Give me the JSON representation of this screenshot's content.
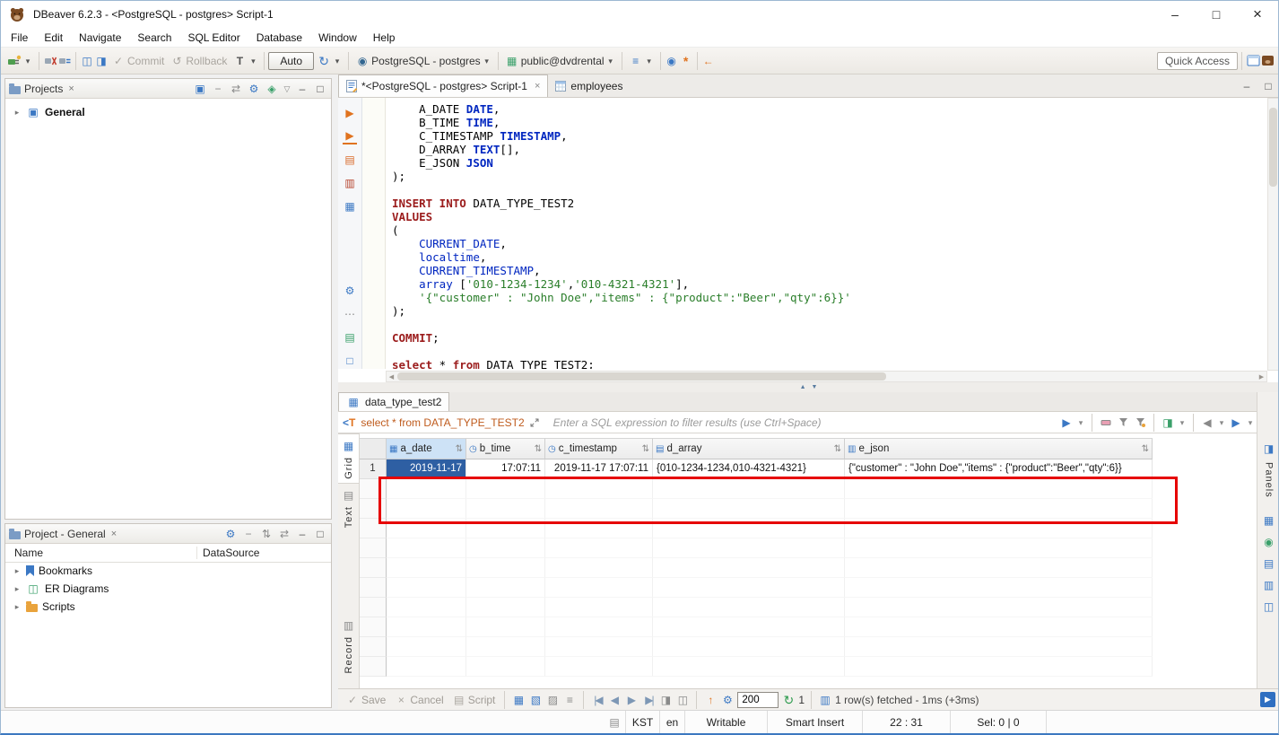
{
  "colors": {
    "keyword": "#9b1c1c",
    "datatype": "#0026c0",
    "string": "#2a7e2a",
    "filter_sql": "#bf5b1d",
    "selection_blue": "#2e5fa3",
    "header_selected": "#cde2f6",
    "annotation_red": "#e60000",
    "accent": "#3b78c4"
  },
  "icons": {
    "dropdown": "▾",
    "menu_down": "▽",
    "minimize": "–",
    "maximize": "□",
    "close": "×",
    "play": "▶",
    "back": "◀",
    "forward": "▶",
    "first": "|◀",
    "last": "▶|",
    "up": "↑",
    "refresh": "↻",
    "rollback": "↺",
    "check": "✓",
    "gear": "⚙",
    "link": "⇄",
    "sort": "⇅",
    "collapse": "−",
    "dots": "⋯",
    "list": "≡",
    "grid": "▦",
    "sheet": "▤",
    "record": "▥",
    "clock": "◷",
    "panel": "◨",
    "panel2": "◫",
    "diamond": "◈",
    "circle": "◉",
    "box": "▣",
    "square": "□",
    "asterisk": "*",
    "arrow_left": "←",
    "tri_up": "▲",
    "tri_down": "▼",
    "tfilter": "T",
    "shade1": "▧",
    "shade2": "▨"
  },
  "titlebar": {
    "title": "DBeaver 6.2.3 - <PostgreSQL - postgres> Script-1"
  },
  "menu": {
    "items": [
      "File",
      "Edit",
      "Navigate",
      "Search",
      "SQL Editor",
      "Database",
      "Window",
      "Help"
    ]
  },
  "toolbar": {
    "commit": "Commit",
    "rollback": "Rollback",
    "auto_commit": "Auto",
    "connection": "PostgreSQL - postgres",
    "schema": "public@dvdrental",
    "quick_access": "Quick Access"
  },
  "projects_panel": {
    "title": "Projects",
    "root_item": "General"
  },
  "project_panel": {
    "title": "Project - General",
    "columns": {
      "name": "Name",
      "datasource": "DataSource"
    },
    "items": [
      "Bookmarks",
      "ER Diagrams",
      "Scripts"
    ]
  },
  "editor": {
    "tab1": "*<PostgreSQL - postgres> Script-1",
    "tab2": "employees",
    "code": [
      [
        [
          "p",
          "    A_DATE "
        ],
        [
          "t",
          "DATE"
        ],
        [
          "p",
          ","
        ]
      ],
      [
        [
          "p",
          "    B_TIME "
        ],
        [
          "t",
          "TIME"
        ],
        [
          "p",
          ","
        ]
      ],
      [
        [
          "p",
          "    C_TIMESTAMP "
        ],
        [
          "t",
          "TIMESTAMP"
        ],
        [
          "p",
          ","
        ]
      ],
      [
        [
          "p",
          "    D_ARRAY "
        ],
        [
          "t",
          "TEXT"
        ],
        [
          "p",
          "[],"
        ]
      ],
      [
        [
          "p",
          "    E_JSON "
        ],
        [
          "t",
          "JSON"
        ]
      ],
      [
        [
          "p",
          ");"
        ]
      ],
      [],
      [
        [
          "k",
          "INSERT INTO"
        ],
        [
          "p",
          " DATA_TYPE_TEST2"
        ]
      ],
      [
        [
          "k",
          "VALUES"
        ]
      ],
      [
        [
          "p",
          "("
        ]
      ],
      [
        [
          "p",
          "    "
        ],
        [
          "f",
          "CURRENT_DATE"
        ],
        [
          "p",
          ","
        ]
      ],
      [
        [
          "p",
          "    "
        ],
        [
          "f",
          "localtime"
        ],
        [
          "p",
          ","
        ]
      ],
      [
        [
          "p",
          "    "
        ],
        [
          "f",
          "CURRENT_TIMESTAMP"
        ],
        [
          "p",
          ","
        ]
      ],
      [
        [
          "p",
          "    "
        ],
        [
          "f",
          "array"
        ],
        [
          "p",
          " ["
        ],
        [
          "s",
          "'010-1234-1234'"
        ],
        [
          "p",
          ","
        ],
        [
          "s",
          "'010-4321-4321'"
        ],
        [
          "p",
          "],"
        ]
      ],
      [
        [
          "p",
          "    "
        ],
        [
          "s",
          "'{\"customer\" : \"John Doe\",\"items\" : {\"product\":\"Beer\",\"qty\":6}}'"
        ]
      ],
      [
        [
          "p",
          ");"
        ]
      ],
      [],
      [
        [
          "k",
          "COMMIT"
        ],
        [
          "p",
          ";"
        ]
      ],
      [],
      [
        [
          "k",
          "select"
        ],
        [
          "p",
          " * "
        ],
        [
          "k",
          "from"
        ],
        [
          "p",
          " DATA_TYPE_TEST2;"
        ]
      ]
    ]
  },
  "results": {
    "tab": "data_type_test2",
    "filter_sql": "select * from DATA_TYPE_TEST2",
    "filter_placeholder": "Enter a SQL expression to filter results (use Ctrl+Space)",
    "side_tabs": [
      "Grid",
      "Text",
      "Record"
    ],
    "panels_label": "Panels",
    "grid": {
      "columns": [
        {
          "name": "a_date",
          "icon": "date"
        },
        {
          "name": "b_time",
          "icon": "time"
        },
        {
          "name": "c_timestamp",
          "icon": "time"
        },
        {
          "name": "d_array",
          "icon": "array"
        },
        {
          "name": "e_json",
          "icon": "json"
        }
      ],
      "rows": [
        {
          "num": "1",
          "cells": [
            "2019-11-17",
            "17:07:11",
            "2019-11-17 17:07:11",
            "{010-1234-1234,010-4321-4321}",
            "{\"customer\" : \"John Doe\",\"items\" : {\"product\":\"Beer\",\"qty\":6}}"
          ]
        }
      ]
    },
    "toolbar": {
      "save": "Save",
      "cancel": "Cancel",
      "script": "Script",
      "fetch_size": "200",
      "refresh_count": "1",
      "status": "1 row(s) fetched - 1ms (+3ms)"
    }
  },
  "statusbar": {
    "timezone": "KST",
    "language": "en",
    "write_mode": "Writable",
    "insert_mode": "Smart Insert",
    "caret_position": "22 : 31",
    "selection": "Sel: 0 | 0"
  }
}
